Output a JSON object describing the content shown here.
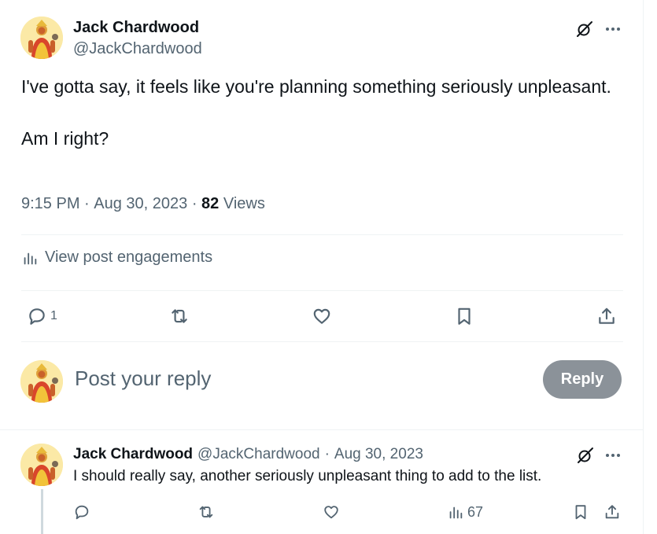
{
  "post": {
    "author_name": "Jack Chardwood",
    "author_handle": "@JackChardwood",
    "text": "I've gotta say, it feels like you're planning something seriously unpleasant.\n\nAm I right?",
    "time": "9:15 PM",
    "date": "Aug 30, 2023",
    "views_count": "82",
    "views_label": "Views",
    "engagements_label": "View post engagements",
    "reply_count": "1"
  },
  "composer": {
    "placeholder": "Post your reply",
    "reply_button": "Reply"
  },
  "reply": {
    "author_name": "Jack Chardwood",
    "author_handle": "@JackChardwood",
    "date": "Aug 30, 2023",
    "text": "I should really say, another seriously unpleasant thing to add to the list.",
    "views_count": "67"
  },
  "icons": {
    "grok": "grok-icon",
    "more": "more-icon",
    "reply": "reply-icon",
    "repost": "repost-icon",
    "like": "like-icon",
    "bookmark": "bookmark-icon",
    "share": "share-icon",
    "analytics": "analytics-icon"
  }
}
